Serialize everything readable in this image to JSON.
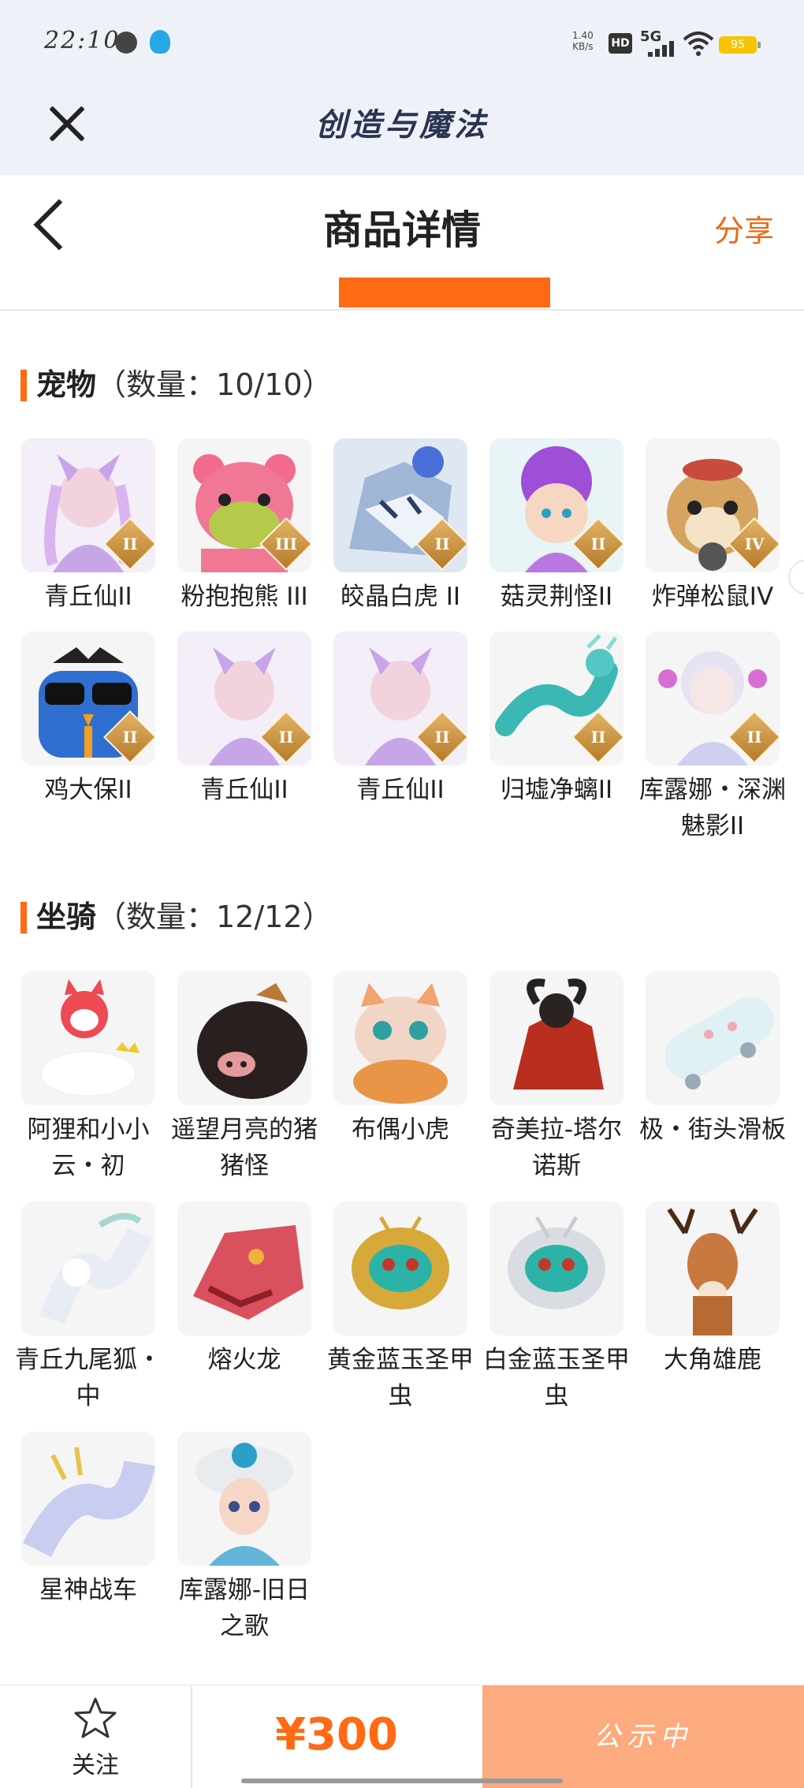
{
  "status_bar": {
    "time": "22:10",
    "net_speed_value": "1.40",
    "net_speed_unit": "KB/s",
    "hd_label": "HD",
    "network": "5G",
    "battery": "95"
  },
  "app_header": {
    "title": "创造与魔法"
  },
  "nav": {
    "title": "商品详情",
    "share_label": "分享"
  },
  "pets": {
    "title": "宠物",
    "count_text": "（数量：10/10）",
    "items": [
      {
        "name": "青丘仙II",
        "badge": "II"
      },
      {
        "name": "粉抱抱熊 III",
        "badge": "III"
      },
      {
        "name": "皎晶白虎 II",
        "badge": "II"
      },
      {
        "name": "菇灵荆怪II",
        "badge": "II"
      },
      {
        "name": "炸弹松鼠IV",
        "badge": "IV"
      },
      {
        "name": "鸡大保II",
        "badge": "II"
      },
      {
        "name": "青丘仙II",
        "badge": "II"
      },
      {
        "name": "青丘仙II",
        "badge": "II"
      },
      {
        "name": "归墟净螭II",
        "badge": "II"
      },
      {
        "name": "库露娜・深渊魅影II",
        "badge": "II"
      }
    ]
  },
  "mounts": {
    "title": "坐骑",
    "count_text": "（数量：12/12）",
    "items": [
      {
        "name": "阿狸和小小云・初"
      },
      {
        "name": "遥望月亮的猪猪怪"
      },
      {
        "name": "布偶小虎"
      },
      {
        "name": "奇美拉-塔尔诺斯"
      },
      {
        "name": "极・街头滑板"
      },
      {
        "name": "青丘九尾狐・中"
      },
      {
        "name": "熔火龙"
      },
      {
        "name": "黄金蓝玉圣甲虫"
      },
      {
        "name": "白金蓝玉圣甲虫"
      },
      {
        "name": "大角雄鹿"
      },
      {
        "name": "星神战车"
      },
      {
        "name": "库露娜-旧日之歌"
      }
    ]
  },
  "bottom_bar": {
    "follow_label": "关注",
    "price": "¥300",
    "status_label": "公示中"
  },
  "colors": {
    "accent": "#ff6a12",
    "status_button": "#fcab7e",
    "header_bg": "#eef2f8"
  }
}
